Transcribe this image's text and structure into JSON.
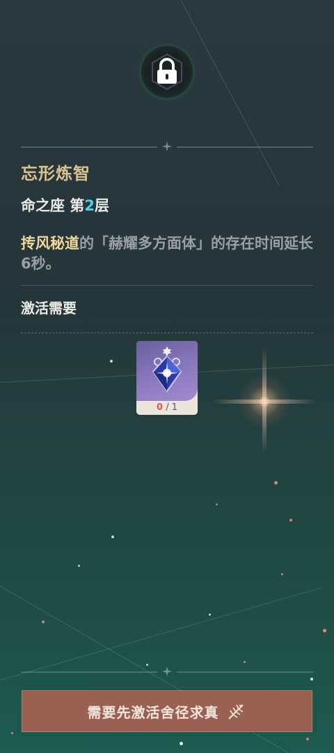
{
  "constellation": {
    "status_icon": "lock-icon",
    "title": "忘形炼智",
    "layer_prefix": "命之座 第",
    "layer_number": "2",
    "layer_suffix": "层",
    "description": {
      "highlight": "抟风秘道",
      "text": "的「赫耀多方面体」的存在时间延长6秒。"
    }
  },
  "requirement": {
    "label": "激活需要",
    "item": {
      "icon": "crystal-gem-icon",
      "have": "0",
      "separator": "/",
      "need": "1"
    }
  },
  "action_button": {
    "label": "需要先激活舍径求真",
    "icon": "feather-arrow-icon"
  },
  "colors": {
    "title_gold": "#d9c28e",
    "layer_number_cyan": "#4cd3f0",
    "highlight_gold": "#f3d79a",
    "button_bg": "#9a6052",
    "count_red": "#e05a48"
  }
}
